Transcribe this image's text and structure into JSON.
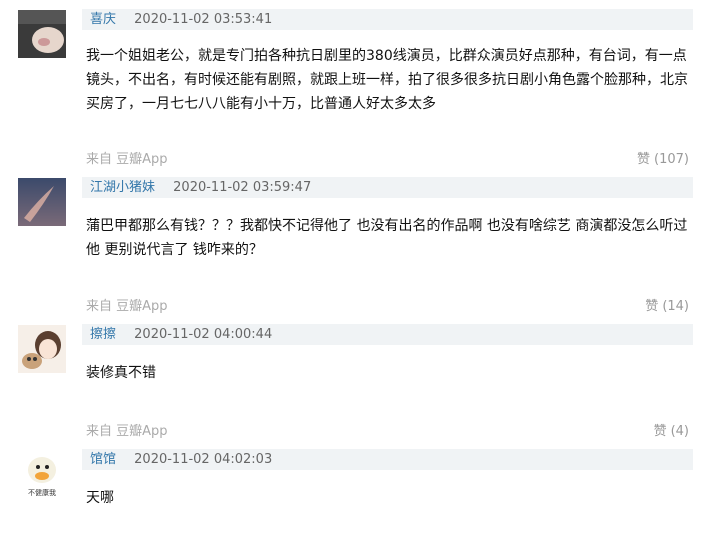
{
  "comments": [
    {
      "author": "喜庆",
      "time": "2020-11-02 03:53:41",
      "text": "我一个姐姐老公，就是专门拍各种抗日剧里的380线演员，比群众演员好点那种，有台词，有一点镜头，不出名，有时候还能有剧照，就跟上班一样，拍了很多很多抗日剧小角色露个脸那种，北京买房了，一月七七八八能有小十万，比普通人好太多太多",
      "source": "来自 豆瓣App",
      "vote_label": "赞",
      "vote_count": "(107)"
    },
    {
      "author": "江湖小猪妹",
      "time": "2020-11-02 03:59:47",
      "text": "蒲巴甲都那么有钱？？？我都快不记得他了 也没有出名的作品啊 也没有啥综艺 商演都没怎么听过他 更别说代言了 钱咋来的？",
      "source": "来自 豆瓣App",
      "vote_label": "赞",
      "vote_count": "(14)"
    },
    {
      "author": "擦擦",
      "time": "2020-11-02 04:00:44",
      "text": "装修真不错",
      "source": "来自 豆瓣App",
      "vote_label": "赞",
      "vote_count": "(4)"
    },
    {
      "author": "馆馆",
      "time": "2020-11-02 04:02:03",
      "text": "天哪",
      "avatar_caption": "不健康我"
    }
  ],
  "colors": {
    "author_link": "#3377aa",
    "meta_bar_bg": "#f0f3f5",
    "muted_text": "#aaaaaa"
  }
}
